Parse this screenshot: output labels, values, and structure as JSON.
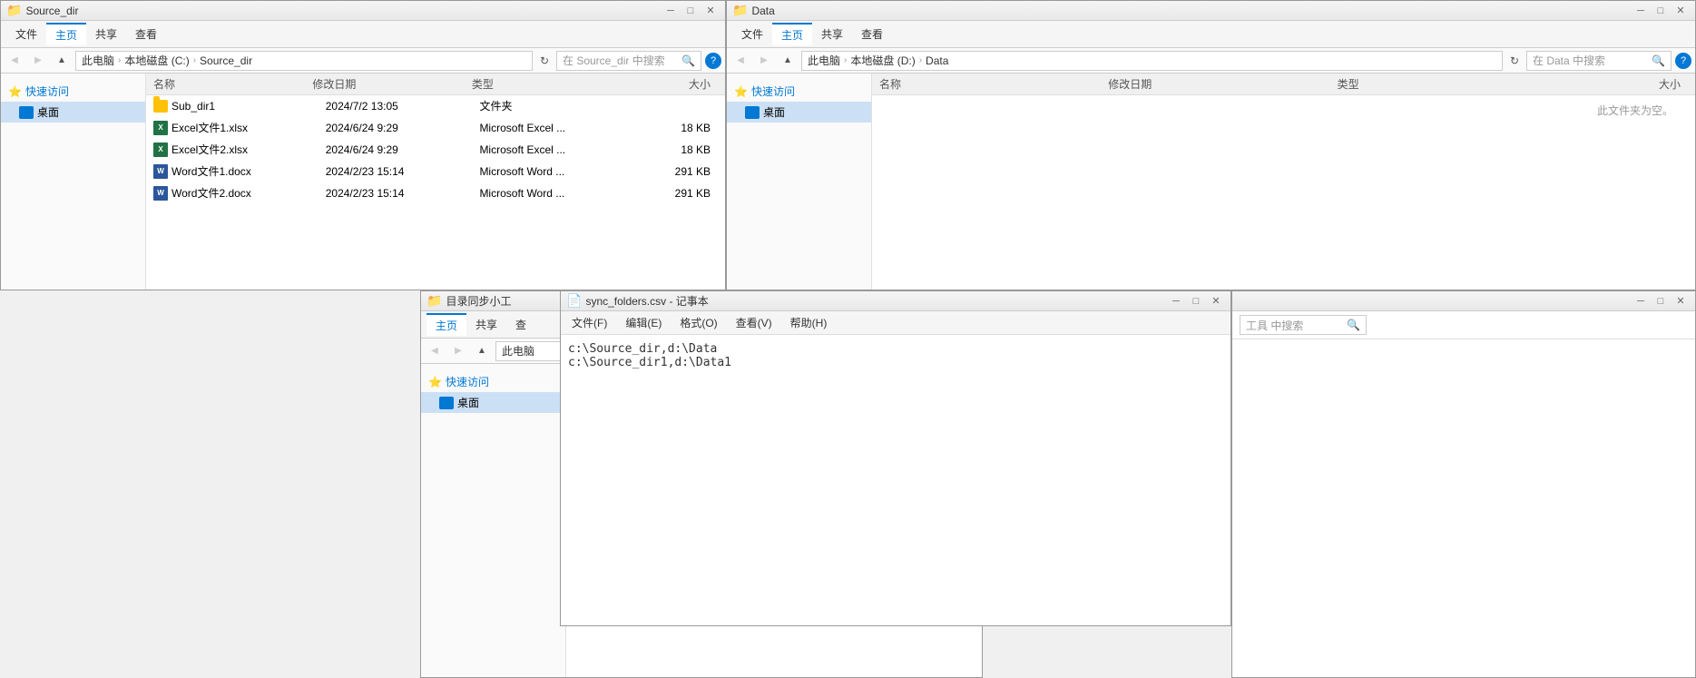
{
  "windows": {
    "source_dir": {
      "title": "Source_dir",
      "titlebar_buttons": [
        "minimize",
        "maximize",
        "close"
      ],
      "tabs": [
        "文件",
        "主页",
        "共享",
        "查看"
      ],
      "active_tab": "主页",
      "address": {
        "parts": [
          "此电脑",
          "本地磁盘 (C:)",
          "Source_dir"
        ],
        "search_placeholder": "在 Source_dir 中搜索"
      },
      "sidebar": {
        "quick_access_label": "快速访问",
        "items": [
          {
            "label": "桌面",
            "active": true
          }
        ]
      },
      "columns": [
        "名称",
        "修改日期",
        "类型",
        "大小"
      ],
      "files": [
        {
          "name": "Sub_dir1",
          "date": "2024/7/2 13:05",
          "type": "文件夹",
          "size": "",
          "icon": "folder"
        },
        {
          "name": "Excel文件1.xlsx",
          "date": "2024/6/24 9:29",
          "type": "Microsoft Excel ...",
          "size": "18 KB",
          "icon": "excel"
        },
        {
          "name": "Excel文件2.xlsx",
          "date": "2024/6/24 9:29",
          "type": "Microsoft Excel ...",
          "size": "18 KB",
          "icon": "excel"
        },
        {
          "name": "Word文件1.docx",
          "date": "2024/2/23 15:14",
          "type": "Microsoft Word ...",
          "size": "291 KB",
          "icon": "word"
        },
        {
          "name": "Word文件2.docx",
          "date": "2024/2/23 15:14",
          "type": "Microsoft Word ...",
          "size": "291 KB",
          "icon": "word"
        }
      ]
    },
    "data": {
      "title": "Data",
      "titlebar_buttons": [
        "minimize",
        "maximize",
        "close"
      ],
      "tabs": [
        "文件",
        "主页",
        "共享",
        "查看"
      ],
      "active_tab": "主页",
      "address": {
        "parts": [
          "此电脑",
          "本地磁盘 (D:)",
          "Data"
        ],
        "search_placeholder": "在 Data 中搜索"
      },
      "sidebar": {
        "quick_access_label": "快速访问",
        "items": [
          {
            "label": "桌面",
            "active": true
          }
        ]
      },
      "columns": [
        "名称",
        "修改日期",
        "类型",
        "大小"
      ],
      "empty_message": "此文件夹为空。",
      "files": []
    },
    "small_explorer": {
      "title": "目录同步小工",
      "tabs": [
        "主页",
        "共享",
        "查"
      ],
      "address_parts": [
        "此电脑"
      ],
      "sidebar": {
        "quick_access_label": "快速访问",
        "items": [
          {
            "label": "桌面",
            "active": true
          }
        ]
      }
    },
    "notepad": {
      "title": "sync_folders.csv - 记事本",
      "menu_items": [
        "文件(F)",
        "编辑(E)",
        "格式(O)",
        "查看(V)",
        "帮助(H)"
      ],
      "content": "c:\\Source_dir,d:\\Data\nc:\\Source_dir1,d:\\Data1"
    }
  }
}
